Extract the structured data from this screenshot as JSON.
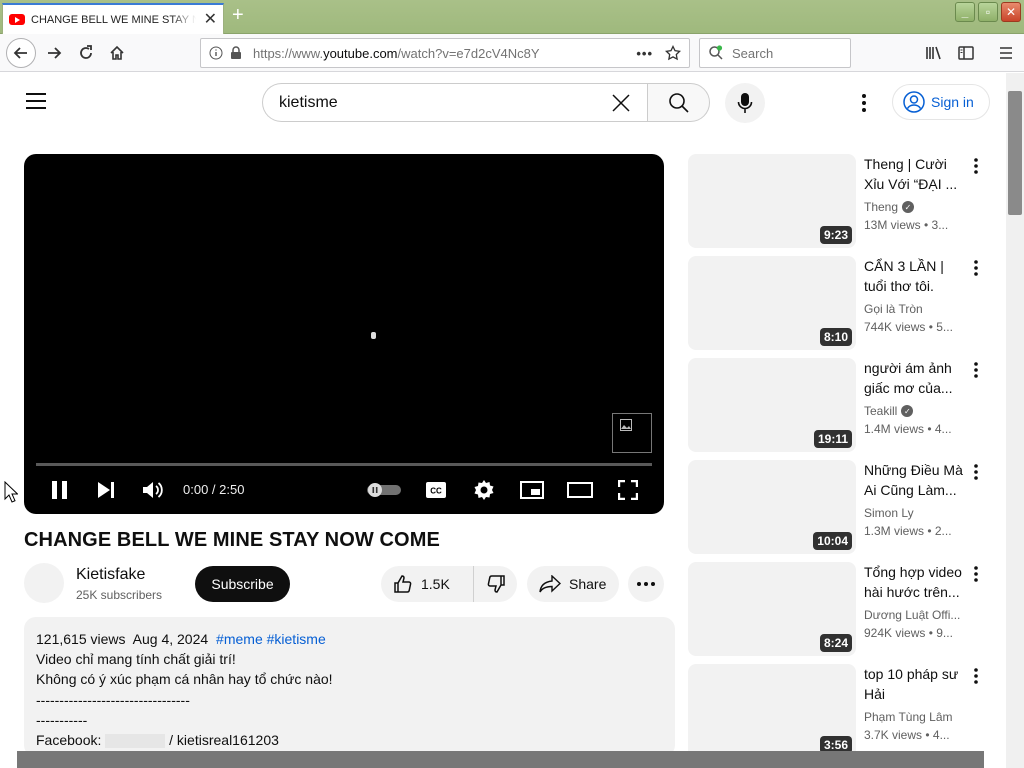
{
  "browser": {
    "tab_title": "CHANGE BELL WE MINE STAY NOW COME",
    "url_prefix": "https://www.",
    "url_host": "youtube.com",
    "url_path": "/watch?v=e7d2cV4Nc8Y",
    "search_placeholder": "Search"
  },
  "header": {
    "search_value": "kietisme",
    "sign_in": "Sign in"
  },
  "player": {
    "time": "0:00 / 2:50",
    "progress_fraction": 0
  },
  "video": {
    "title": "CHANGE BELL WE MINE STAY NOW COME",
    "channel": "Kietisfake",
    "subscribers": "25K subscribers",
    "subscribe_label": "Subscribe",
    "likes": "1.5K",
    "share_label": "Share"
  },
  "description": {
    "views": "121,615 views",
    "date": "Aug 4, 2024",
    "tags": "#meme #kietisme",
    "line1": "Video chỉ mang tính chất giải trí!",
    "line2": "Không có ý xúc phạm cá nhân hay tổ chức nào!",
    "sep1": "---------------------------------",
    "sep2": "-----------",
    "facebook_label": "Facebook:",
    "facebook_handle": "/ kietisreal161203"
  },
  "recommendations": [
    {
      "title": "Theng | Cười Xỉu Với “ĐẠI ...",
      "channel": "Theng",
      "verified": true,
      "views": "13M views  • 3...",
      "duration": "9:23"
    },
    {
      "title": "CẨN 3 LẦN | tuổi thơ tôi.",
      "channel": "Gọi là Tròn",
      "verified": false,
      "views": "744K views  • 5...",
      "duration": "8:10"
    },
    {
      "title": "người ám ảnh giấc mơ của...",
      "channel": "Teakill",
      "verified": true,
      "views": "1.4M views  • 4...",
      "duration": "19:11"
    },
    {
      "title": "Những Điều Mà Ai Cũng Làm...",
      "channel": "Simon Ly",
      "verified": false,
      "views": "1.3M views  • 2...",
      "duration": "10:04"
    },
    {
      "title": "Tổng hợp video hài hước trên...",
      "channel": "Dương Luật Offi...",
      "verified": false,
      "views": "924K views  • 9...",
      "duration": "8:24"
    },
    {
      "title": "top 10 pháp sư Hải",
      "channel": "Phạm Tùng Lâm",
      "verified": false,
      "views": "3.7K views  • 4...",
      "duration": "3:56"
    }
  ]
}
